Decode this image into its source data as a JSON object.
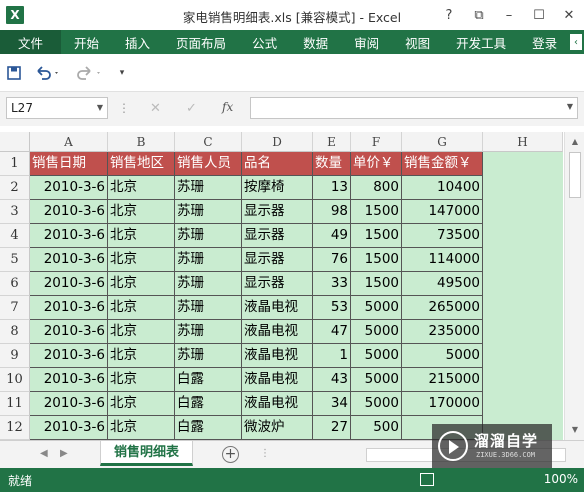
{
  "window": {
    "title": "家电销售明细表.xls  [兼容模式] - Excel",
    "logo_letter": "X",
    "controls": [
      "?",
      "⧉",
      "–",
      "☐",
      "✕"
    ]
  },
  "ribbon": {
    "tabs": [
      "文件",
      "开始",
      "插入",
      "页面布局",
      "公式",
      "数据",
      "审阅",
      "视图",
      "开发工具",
      "登录"
    ]
  },
  "formula_bar": {
    "name_box": "L27",
    "cancel": "✕",
    "confirm": "✓",
    "fx": "fx",
    "formula": ""
  },
  "sheet": {
    "columns": [
      "A",
      "B",
      "C",
      "D",
      "E",
      "F",
      "G",
      "H"
    ],
    "rows": [
      "1",
      "2",
      "3",
      "4",
      "5",
      "6",
      "7",
      "8",
      "9",
      "10",
      "11",
      "12"
    ],
    "header": [
      "销售日期",
      "销售地区",
      "销售人员",
      "品名",
      "数量",
      "单价￥",
      "销售金额￥"
    ],
    "data": [
      [
        "2010-3-6",
        "北京",
        "苏珊",
        "按摩椅",
        "13",
        "800",
        "10400"
      ],
      [
        "2010-3-6",
        "北京",
        "苏珊",
        "显示器",
        "98",
        "1500",
        "147000"
      ],
      [
        "2010-3-6",
        "北京",
        "苏珊",
        "显示器",
        "49",
        "1500",
        "73500"
      ],
      [
        "2010-3-6",
        "北京",
        "苏珊",
        "显示器",
        "76",
        "1500",
        "114000"
      ],
      [
        "2010-3-6",
        "北京",
        "苏珊",
        "显示器",
        "33",
        "1500",
        "49500"
      ],
      [
        "2010-3-6",
        "北京",
        "苏珊",
        "液晶电视",
        "53",
        "5000",
        "265000"
      ],
      [
        "2010-3-6",
        "北京",
        "苏珊",
        "液晶电视",
        "47",
        "5000",
        "235000"
      ],
      [
        "2010-3-6",
        "北京",
        "苏珊",
        "液晶电视",
        "1",
        "5000",
        "5000"
      ],
      [
        "2010-3-6",
        "北京",
        "白露",
        "液晶电视",
        "43",
        "5000",
        "215000"
      ],
      [
        "2010-3-6",
        "北京",
        "白露",
        "液晶电视",
        "34",
        "5000",
        "170000"
      ],
      [
        "2010-3-6",
        "北京",
        "白露",
        "微波炉",
        "27",
        "500",
        ""
      ]
    ],
    "colors": {
      "header_fill": "#c0504d",
      "data_fill": "#c9ecd0"
    }
  },
  "sheet_tabs": {
    "active": "销售明细表",
    "add": "+"
  },
  "status": {
    "text": "就绪",
    "zoom": "100%"
  },
  "watermark": {
    "title": "溜溜自学",
    "sub": "ZIXUE.3D66.COM"
  },
  "theme": {
    "accent": "#217346"
  }
}
